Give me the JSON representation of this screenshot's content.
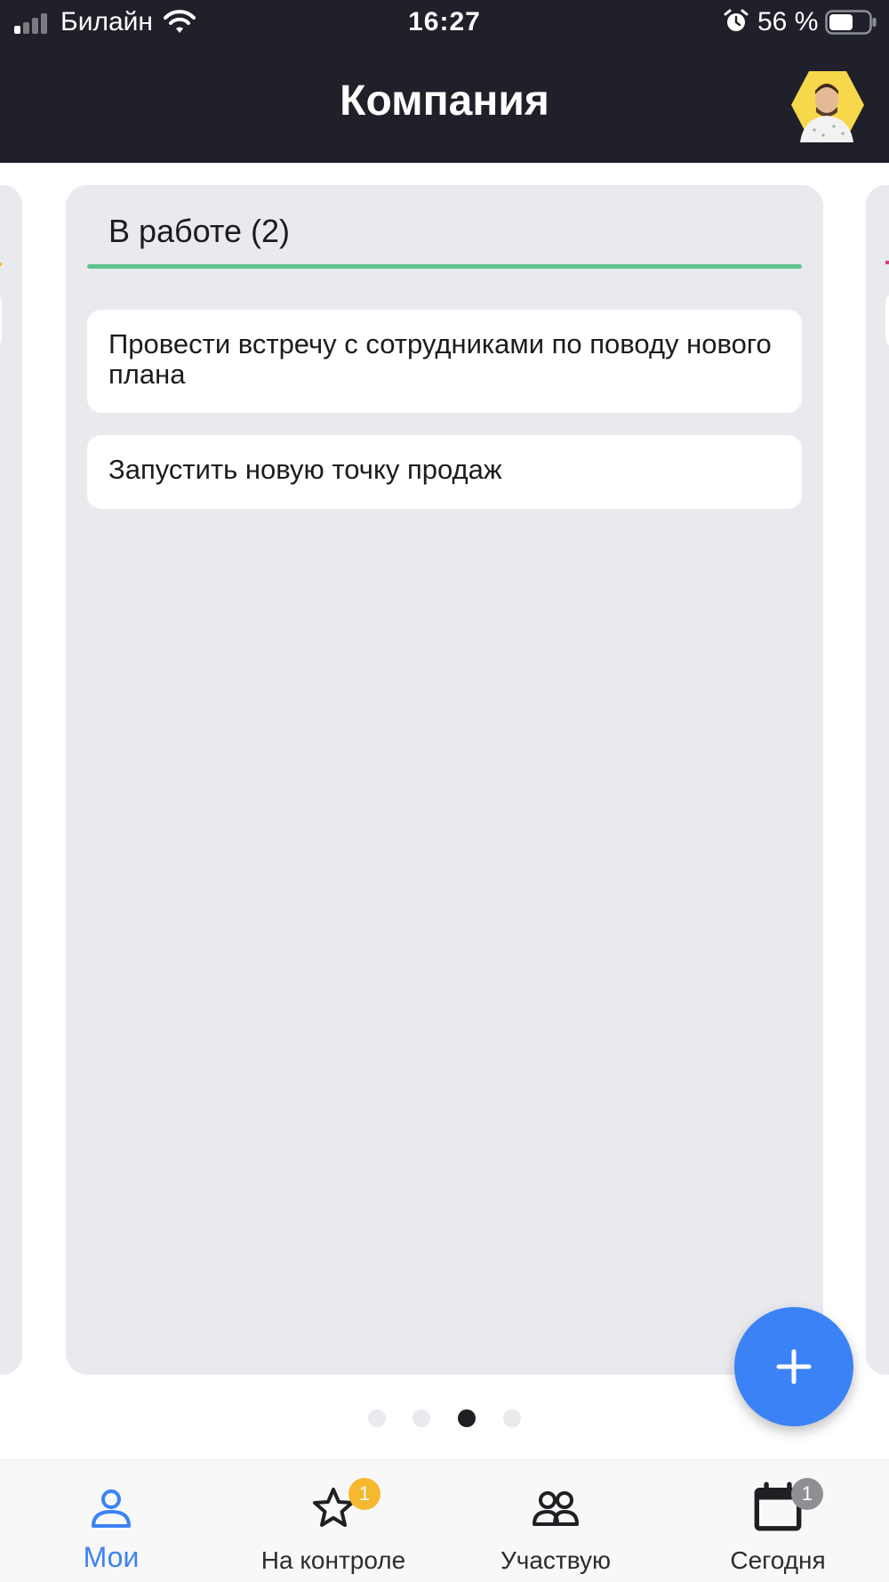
{
  "status_bar": {
    "carrier": "Билайн",
    "time": "16:27",
    "battery": "56 %",
    "icons": [
      "signal-icon",
      "wifi-icon",
      "alarm-icon",
      "battery-icon"
    ]
  },
  "header": {
    "title": "Компания",
    "avatar": "user-avatar"
  },
  "board": {
    "column": {
      "title": "В работе (2)",
      "accent_color": "#5ec28a",
      "cards": [
        {
          "title": "Провести встречу с сотрудниками по поводу нового плана"
        },
        {
          "title": "Запустить новую точку продаж"
        }
      ]
    },
    "pages": {
      "count": 4,
      "active": 3
    }
  },
  "fab": {
    "icon": "plus-icon",
    "color": "#3b82f6"
  },
  "tabbar": {
    "tabs": [
      {
        "label": "Мои",
        "icon": "user-icon",
        "active": true
      },
      {
        "label": "На контроле",
        "icon": "star-icon",
        "badge": "1",
        "badge_color": "#f5b82e"
      },
      {
        "label": "Участвую",
        "icon": "people-icon"
      },
      {
        "label": "Сегодня",
        "icon": "calendar-icon",
        "badge": "1",
        "badge_color": "#8e8e93"
      }
    ]
  },
  "colors": {
    "header_bg": "#1f2029",
    "column_bg": "#e9eaee",
    "accent_blue": "#3b82f6"
  }
}
